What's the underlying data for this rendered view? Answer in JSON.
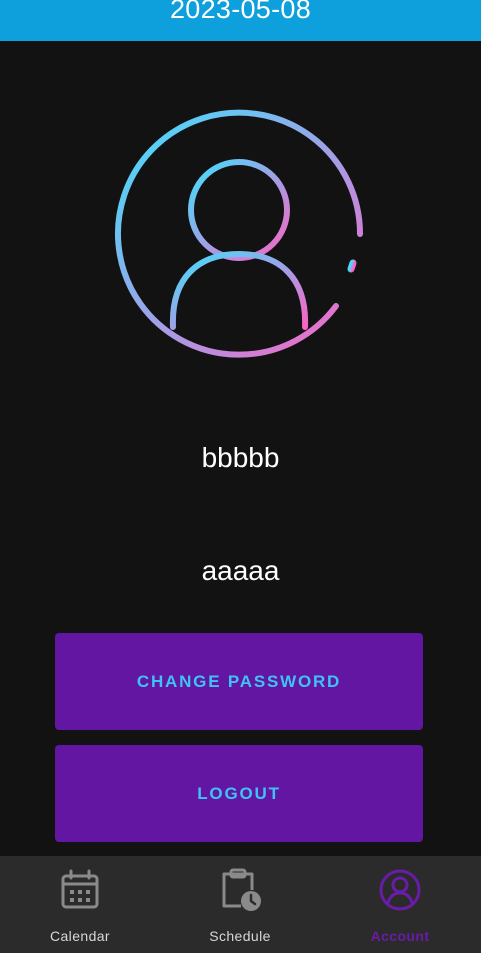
{
  "header": {
    "date": "2023-05-08",
    "background_color": "#0ea0dc"
  },
  "profile": {
    "avatar_icon": "user-circle-gradient-icon",
    "name": "bbbbb",
    "second_line": "aaaaa"
  },
  "actions": {
    "change_password_label": "CHANGE PASSWORD",
    "logout_label": "LOGOUT",
    "button_color": "#6216a1",
    "label_color": "#3fc2f5"
  },
  "bottom_nav": {
    "active": "Account",
    "items": [
      {
        "label": "Calendar",
        "icon": "calendar-icon"
      },
      {
        "label": "Schedule",
        "icon": "schedule-clipboard-icon"
      },
      {
        "label": "Account",
        "icon": "account-circle-icon"
      }
    ],
    "active_color": "#6a1ba7"
  }
}
